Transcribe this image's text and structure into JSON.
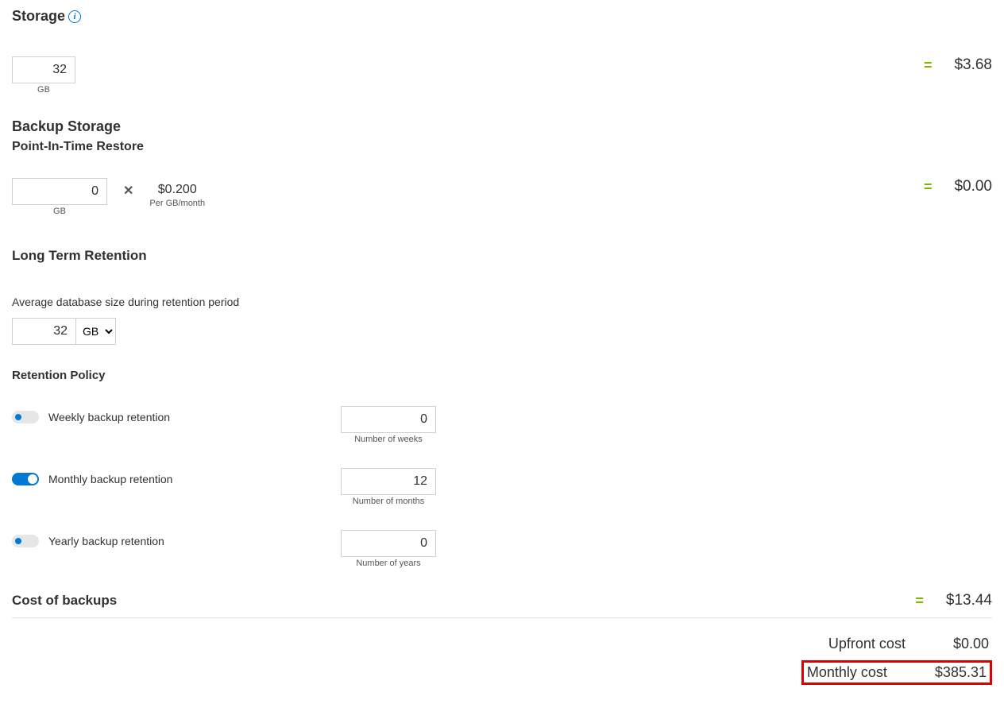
{
  "storage": {
    "heading": "Storage",
    "value": "32",
    "unit": "GB",
    "price": "$3.68"
  },
  "backup": {
    "heading": "Backup Storage",
    "subheading": "Point-In-Time Restore",
    "value": "0",
    "unit": "GB",
    "rate": "$0.200",
    "rate_label": "Per GB/month",
    "price": "$0.00"
  },
  "ltr": {
    "heading": "Long Term Retention",
    "avg_label": "Average database size during retention period",
    "avg_value": "32",
    "avg_unit": "GB",
    "policy_heading": "Retention Policy",
    "weekly": {
      "label": "Weekly backup retention",
      "value": "0",
      "caption": "Number of weeks"
    },
    "monthly": {
      "label": "Monthly backup retention",
      "value": "12",
      "caption": "Number of months"
    },
    "yearly": {
      "label": "Yearly backup retention",
      "value": "0",
      "caption": "Number of years"
    }
  },
  "cost": {
    "backups_label": "Cost of backups",
    "backups_price": "$13.44",
    "upfront_label": "Upfront cost",
    "upfront_value": "$0.00",
    "monthly_label": "Monthly cost",
    "monthly_value": "$385.31"
  },
  "symbols": {
    "eq": "=",
    "mult": "✕"
  }
}
